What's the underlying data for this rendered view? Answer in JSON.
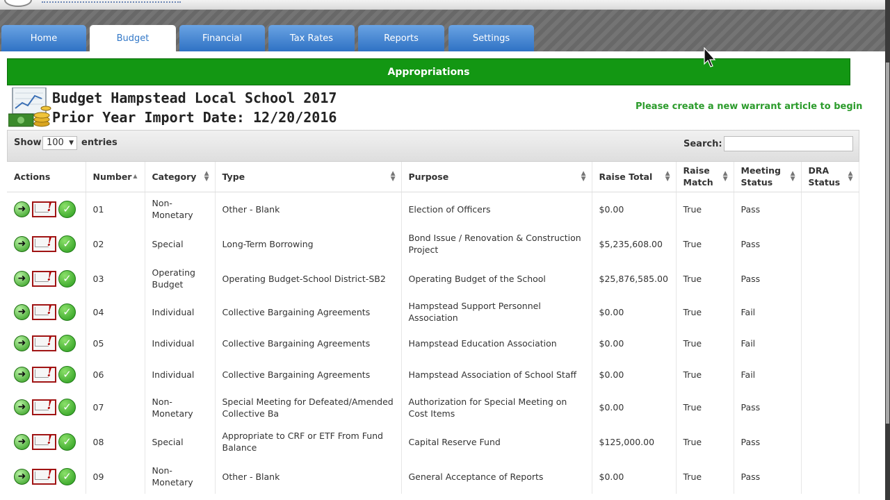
{
  "nav": {
    "tabs": [
      {
        "label": "Home",
        "active": false
      },
      {
        "label": "Budget",
        "active": true
      },
      {
        "label": "Financial",
        "active": false
      },
      {
        "label": "Tax Rates",
        "active": false
      },
      {
        "label": "Reports",
        "active": false
      },
      {
        "label": "Settings",
        "active": false
      }
    ]
  },
  "section": {
    "title": "Appropriations"
  },
  "budget": {
    "title": "Budget Hampstead Local School 2017",
    "import_line": "Prior Year Import Date: 12/20/2016",
    "warrant_message": "Please create a new warrant article to begin"
  },
  "controls": {
    "show_label": "Show",
    "entries_value": "100",
    "entries_label": "entries",
    "search_label": "Search:",
    "search_value": ""
  },
  "table": {
    "columns": [
      "Actions",
      "Number",
      "Category",
      "Type",
      "Purpose",
      "Raise Total",
      "Raise Match",
      "Meeting Status",
      "DRA Status"
    ],
    "rows": [
      {
        "number": "01",
        "category": "Non-Monetary",
        "type": "Other - Blank",
        "purpose": "Election of Officers",
        "raise_total": "$0.00",
        "raise_match": "True",
        "meeting_status": "Pass",
        "dra_status": ""
      },
      {
        "number": "02",
        "category": "Special",
        "type": "Long-Term Borrowing",
        "purpose": "Bond Issue / Renovation & Construction Project",
        "raise_total": "$5,235,608.00",
        "raise_match": "True",
        "meeting_status": "Pass",
        "dra_status": ""
      },
      {
        "number": "03",
        "category": "Operating Budget",
        "type": "Operating Budget-School District-SB2",
        "purpose": "Operating Budget of the School",
        "raise_total": "$25,876,585.00",
        "raise_match": "True",
        "meeting_status": "Pass",
        "dra_status": ""
      },
      {
        "number": "04",
        "category": "Individual",
        "type": "Collective Bargaining Agreements",
        "purpose": "Hampstead Support Personnel Association",
        "raise_total": "$0.00",
        "raise_match": "True",
        "meeting_status": "Fail",
        "dra_status": ""
      },
      {
        "number": "05",
        "category": "Individual",
        "type": "Collective Bargaining Agreements",
        "purpose": "Hampstead Education Association",
        "raise_total": "$0.00",
        "raise_match": "True",
        "meeting_status": "Fail",
        "dra_status": ""
      },
      {
        "number": "06",
        "category": "Individual",
        "type": "Collective Bargaining Agreements",
        "purpose": "Hampstead Association of School Staff",
        "raise_total": "$0.00",
        "raise_match": "True",
        "meeting_status": "Fail",
        "dra_status": ""
      },
      {
        "number": "07",
        "category": "Non-Monetary",
        "type": "Special Meeting for Defeated/Amended Collective Ba",
        "purpose": "Authorization for Special Meeting on Cost Items",
        "raise_total": "$0.00",
        "raise_match": "True",
        "meeting_status": "Pass",
        "dra_status": ""
      },
      {
        "number": "08",
        "category": "Special",
        "type": "Appropriate to CRF or ETF From Fund Balance",
        "purpose": "Capital Reserve Fund",
        "raise_total": "$125,000.00",
        "raise_match": "True",
        "meeting_status": "Pass",
        "dra_status": ""
      },
      {
        "number": "09",
        "category": "Non-Monetary",
        "type": "Other - Blank",
        "purpose": "General Acceptance of Reports",
        "raise_total": "$0.00",
        "raise_match": "True",
        "meeting_status": "Pass",
        "dra_status": ""
      }
    ]
  },
  "icons": {
    "go": "arrow-right-icon",
    "mail": "mail-alert-icon",
    "check": "check-icon"
  },
  "colors": {
    "header_green": "#139713",
    "tab_blue": "#3479c8",
    "warrant_green": "#2b9b2b"
  }
}
